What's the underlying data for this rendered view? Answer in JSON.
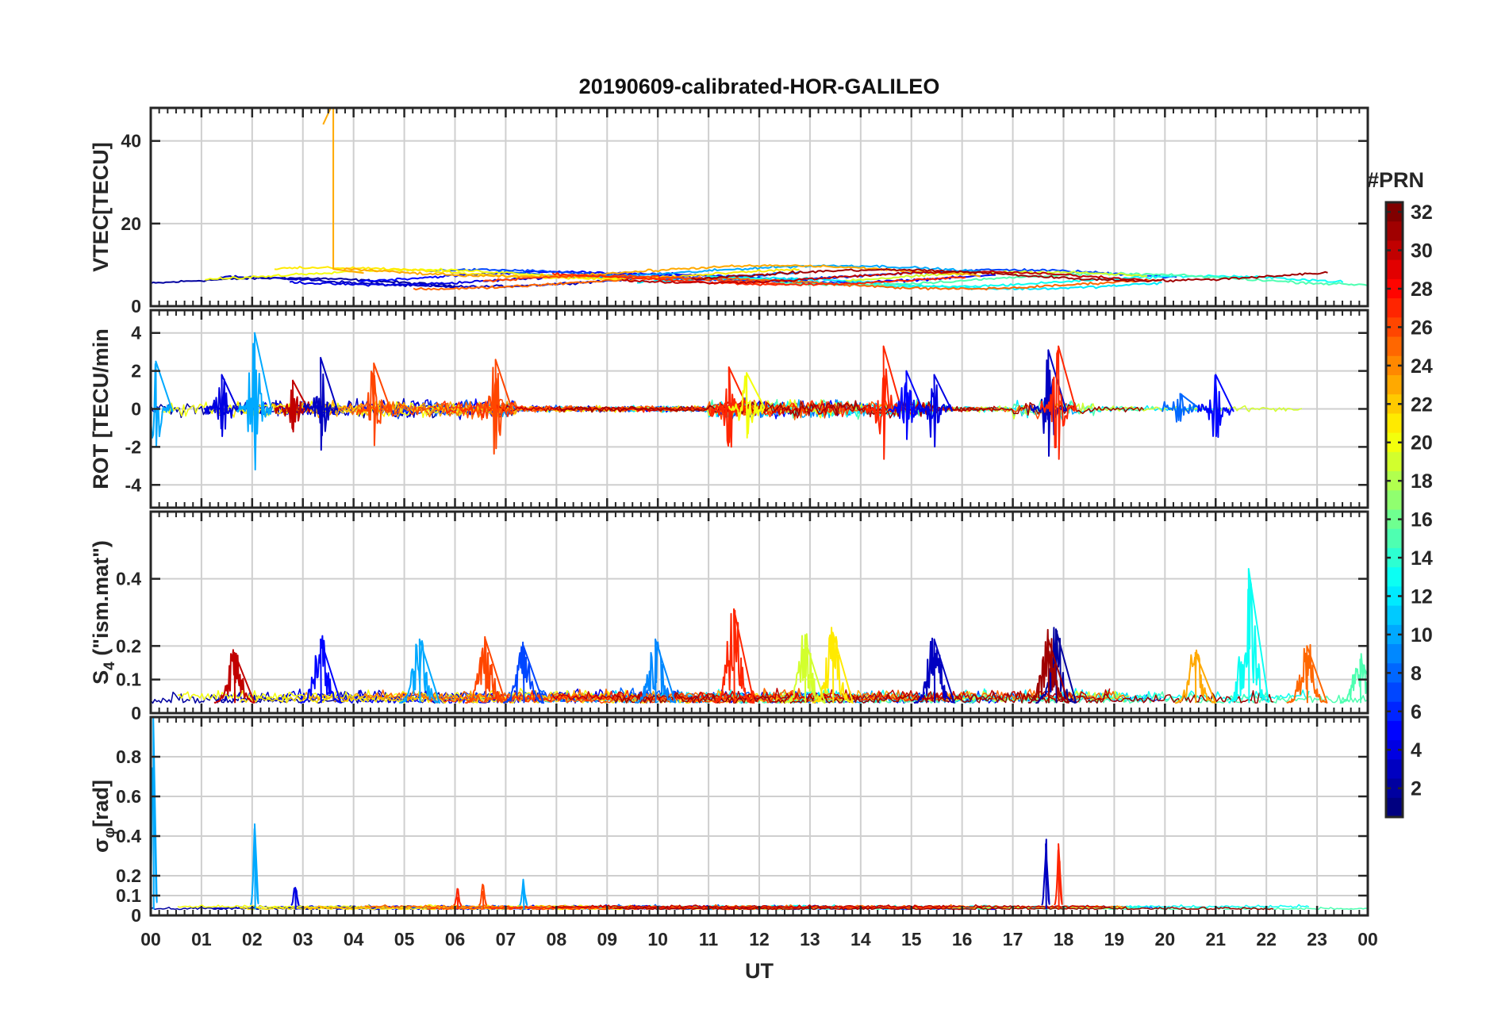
{
  "chart_data": {
    "type": "line",
    "title": "20190609-calibrated-HOR-GALILEO",
    "xlabel": "UT",
    "xlim": [
      0,
      24
    ],
    "x_tick_labels": [
      "00",
      "01",
      "02",
      "03",
      "04",
      "05",
      "06",
      "07",
      "08",
      "09",
      "10",
      "11",
      "12",
      "13",
      "14",
      "15",
      "16",
      "17",
      "18",
      "19",
      "20",
      "21",
      "22",
      "23",
      "00"
    ],
    "colorbar": {
      "label": "#PRN",
      "range": [
        1,
        32
      ],
      "ticks": [
        2,
        4,
        6,
        8,
        10,
        12,
        14,
        16,
        18,
        20,
        22,
        24,
        26,
        28,
        30,
        32
      ],
      "colormap": "jet"
    },
    "panels": [
      {
        "id": "vtec",
        "ylabel": "VTEC[TECU]",
        "ylim": [
          0,
          48
        ],
        "yticks": [
          0,
          20,
          40
        ],
        "spike": {
          "x": 3.6,
          "peak": 48,
          "prn": 23
        },
        "baseline": {
          "min": 4,
          "max": 11,
          "typical": 7
        }
      },
      {
        "id": "rot",
        "ylabel": "ROT [TECU/min",
        "ylim": [
          -5.2,
          5.2
        ],
        "yticks": [
          -4,
          -2,
          0,
          2,
          4
        ],
        "events": [
          {
            "x": 0.1,
            "amp": 2.5,
            "prn": 10
          },
          {
            "x": 1.4,
            "amp": 1.8,
            "prn": 4
          },
          {
            "x": 2.05,
            "amp": 4.0,
            "prn": 10
          },
          {
            "x": 2.8,
            "amp": 1.5,
            "prn": 30
          },
          {
            "x": 3.35,
            "amp": 2.7,
            "prn": 3
          },
          {
            "x": 4.4,
            "amp": 2.4,
            "prn": 26
          },
          {
            "x": 6.8,
            "amp": 2.6,
            "prn": 26
          },
          {
            "x": 11.4,
            "amp": 2.2,
            "prn": 27
          },
          {
            "x": 11.75,
            "amp": 1.9,
            "prn": 20
          },
          {
            "x": 14.45,
            "amp": 3.3,
            "prn": 27
          },
          {
            "x": 14.9,
            "amp": 2.0,
            "prn": 5
          },
          {
            "x": 15.45,
            "amp": 1.8,
            "prn": 4
          },
          {
            "x": 17.7,
            "amp": 3.1,
            "prn": 3
          },
          {
            "x": 17.9,
            "amp": 3.3,
            "prn": 27
          },
          {
            "x": 20.3,
            "amp": 0.8,
            "prn": 8
          },
          {
            "x": 21.0,
            "amp": 1.8,
            "prn": 5
          }
        ]
      },
      {
        "id": "s4",
        "ylabel": "S",
        "ylabel_sub": "4",
        "ylabel_rest": " (\"ism.mat\")",
        "ylim": [
          0,
          0.6
        ],
        "yticks": [
          0,
          0.1,
          0.2,
          0.4
        ],
        "events": [
          {
            "x": 1.65,
            "peak": 0.18,
            "prn": 30
          },
          {
            "x": 3.35,
            "peak": 0.22,
            "prn": 5
          },
          {
            "x": 5.3,
            "peak": 0.22,
            "prn": 10
          },
          {
            "x": 6.6,
            "peak": 0.22,
            "prn": 26
          },
          {
            "x": 7.35,
            "peak": 0.2,
            "prn": 7
          },
          {
            "x": 9.95,
            "peak": 0.22,
            "prn": 9
          },
          {
            "x": 11.5,
            "peak": 0.31,
            "prn": 27
          },
          {
            "x": 12.9,
            "peak": 0.22,
            "prn": 19
          },
          {
            "x": 13.45,
            "peak": 0.24,
            "prn": 21
          },
          {
            "x": 15.45,
            "peak": 0.22,
            "prn": 3
          },
          {
            "x": 17.85,
            "peak": 0.25,
            "prn": 2
          },
          {
            "x": 17.7,
            "peak": 0.22,
            "prn": 31
          },
          {
            "x": 20.6,
            "peak": 0.18,
            "prn": 23
          },
          {
            "x": 21.65,
            "peak": 0.43,
            "prn": 13
          },
          {
            "x": 22.8,
            "peak": 0.2,
            "prn": 25
          },
          {
            "x": 23.85,
            "peak": 0.16,
            "prn": 15
          }
        ]
      },
      {
        "id": "sigphi",
        "ylabel": "σ",
        "ylabel_sub": "φ",
        "ylabel_rest": "[rad]",
        "ylim": [
          0,
          1
        ],
        "yticks": [
          0,
          0.1,
          0.2,
          0.4,
          0.6,
          0.8
        ],
        "events": [
          {
            "x": 0.05,
            "peak": 1.0,
            "prn": 10
          },
          {
            "x": 2.05,
            "peak": 0.46,
            "prn": 10
          },
          {
            "x": 2.85,
            "peak": 0.14,
            "prn": 4
          },
          {
            "x": 6.05,
            "peak": 0.09,
            "prn": 27
          },
          {
            "x": 6.55,
            "peak": 0.12,
            "prn": 26
          },
          {
            "x": 7.35,
            "peak": 0.14,
            "prn": 10
          },
          {
            "x": 17.65,
            "peak": 0.36,
            "prn": 3
          },
          {
            "x": 17.9,
            "peak": 0.36,
            "prn": 27
          }
        ]
      }
    ]
  }
}
